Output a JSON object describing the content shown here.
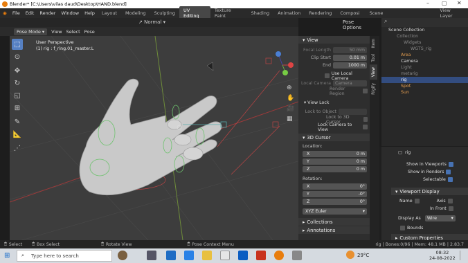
{
  "titlebar": {
    "title": "Blender* [C:\\Users\\vilas daud\\Desktop\\HAND.blend]"
  },
  "menus": [
    "File",
    "Edit",
    "Render",
    "Window",
    "Help"
  ],
  "workspaces": [
    "Layout",
    "Modeling",
    "Sculpting",
    "UV Editing",
    "Texture Paint",
    "Shading",
    "Animation",
    "Rendering",
    "Composi"
  ],
  "active_workspace": "UV Editing",
  "scene": "Scene",
  "view_layer": "View Layer",
  "header": {
    "mode": "Pose Mode",
    "view": "View",
    "select": "Select",
    "pose": "Pose",
    "orientation": "Normal",
    "pose_options": "Pose Options"
  },
  "viewport": {
    "perspective": "User Perspective",
    "info": "(1) rig : f_ring.01_master.L"
  },
  "npanel": {
    "view_section": "View",
    "focal_length_label": "Focal Length",
    "focal_length": "50 mm",
    "clip_start_label": "Clip Start",
    "clip_start": "0.01 m",
    "end_label": "End",
    "end": "1000 m",
    "use_local_camera": "Use Local Camera",
    "local_camera_label": "Local Camera",
    "local_camera": "Camera",
    "render_region": "Render Region",
    "view_lock": "View Lock",
    "lock_to_object": "Lock to Object",
    "lock_3d_cursor": "Lock to 3D Cursor",
    "lock_camera": "Lock Camera to View",
    "cursor_section": "3D Cursor",
    "location": "Location:",
    "x": "X",
    "y": "Y",
    "z": "Z",
    "loc_x": "0 m",
    "loc_y": "0 m",
    "loc_z": "0 m",
    "rotation": "Rotation:",
    "rot_x": "0°",
    "rot_y": "-0°",
    "rot_z": "0°",
    "euler": "XYZ Euler",
    "collections": "Collections",
    "annotations": "Annotations"
  },
  "ntabs": [
    "Item",
    "Tool",
    "View",
    "Rigify"
  ],
  "outliner": {
    "items": [
      "Scene Collection",
      "Collection",
      "Widgets",
      "WGTS_rig",
      "Area",
      "Camera",
      "Light",
      "metarig",
      "rig",
      "Spot",
      "Sun"
    ]
  },
  "properties": {
    "object": "rig",
    "show_viewports": "Show in Viewports",
    "show_renders": "Show in Renders",
    "selectable": "Selectable",
    "viewport_display": "Viewport Display",
    "name": "Name",
    "axis": "Axis",
    "in_front": "In Front",
    "display_as_label": "Display As",
    "display_as": "Wire",
    "bounds": "Bounds",
    "custom_properties": "Custom Properties"
  },
  "statusbar": {
    "select": "Select",
    "box_select": "Box Select",
    "rotate_view": "Rotate View",
    "context_menu": "Pose Context Menu",
    "stats": "rig | Bones:0/96 | Mem: 48.1 MB | 2.83.7"
  },
  "taskbar": {
    "search": "Type here to search",
    "temp": "29°C",
    "time": "08:32",
    "date": "24-08-2022"
  },
  "colors": {
    "accent": "#5680c2",
    "orange": "#e87d0d",
    "green": "#6ec26e"
  }
}
